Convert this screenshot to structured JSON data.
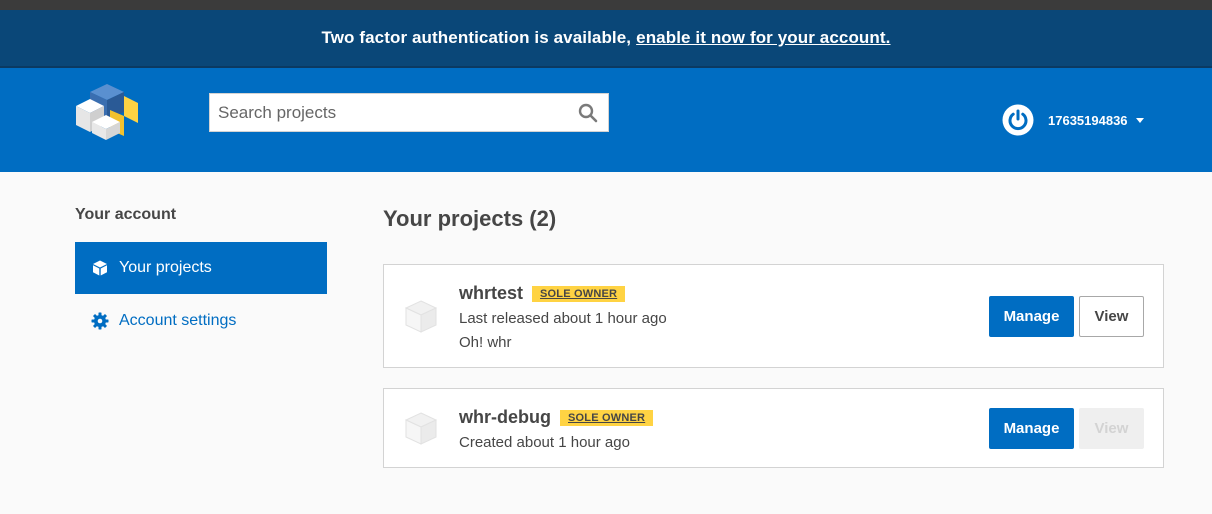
{
  "notice": {
    "text": "Two factor authentication is available,",
    "link": "enable it now for your account."
  },
  "header": {
    "search_placeholder": "Search projects",
    "username": "17635194836"
  },
  "sidebar": {
    "title": "Your account",
    "items": [
      {
        "label": "Your projects",
        "icon": "cube-icon",
        "active": true
      },
      {
        "label": "Account settings",
        "icon": "gear-icon",
        "active": false
      }
    ]
  },
  "main": {
    "title": "Your projects (2)",
    "projects": [
      {
        "name": "whrtest",
        "badge": "SOLE OWNER",
        "released": "Last released about 1 hour ago",
        "description": "Oh! whr",
        "manage_label": "Manage",
        "view_label": "View",
        "view_enabled": true
      },
      {
        "name": "whr-debug",
        "badge": "SOLE OWNER",
        "released": "Created about 1 hour ago",
        "manage_label": "Manage",
        "view_label": "View",
        "view_enabled": false
      }
    ]
  },
  "colors": {
    "brand_blue": "#006dc2",
    "notice_blue": "#0a4778",
    "badge_yellow": "#ffd343"
  }
}
